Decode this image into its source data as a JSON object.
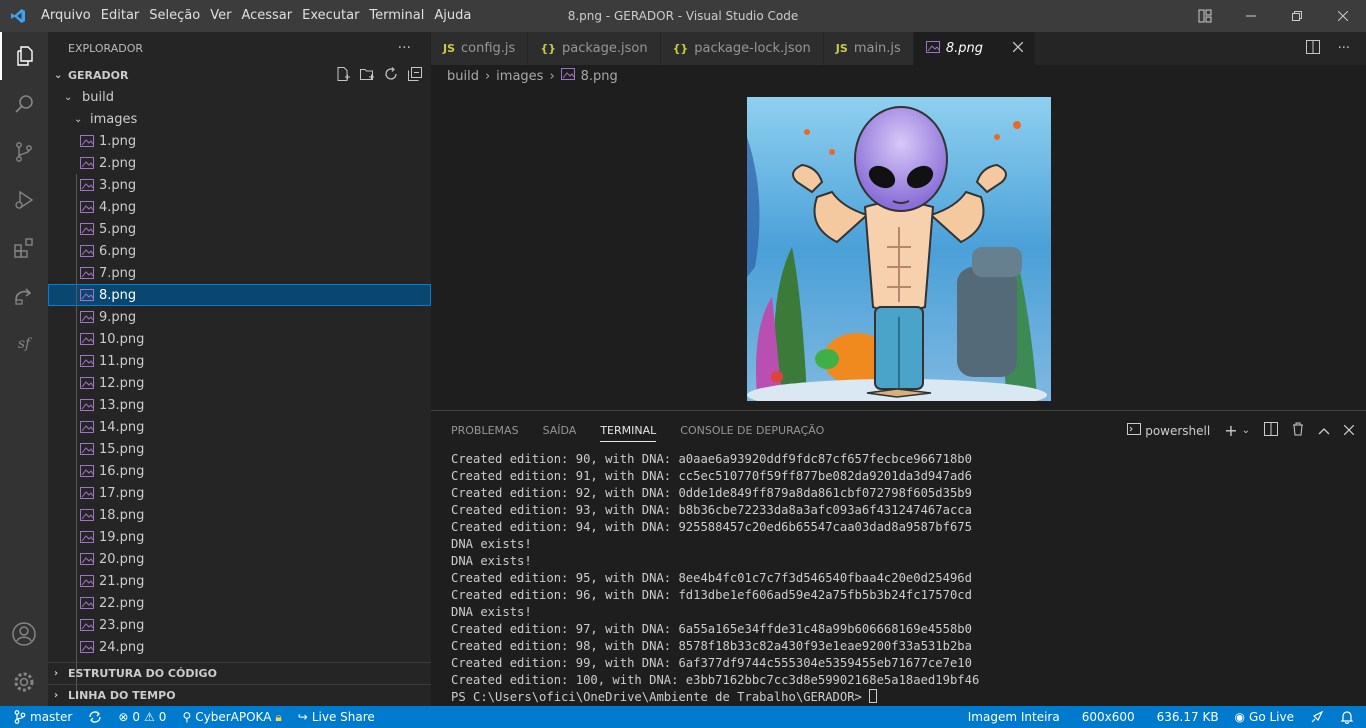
{
  "menu": [
    "Arquivo",
    "Editar",
    "Seleção",
    "Ver",
    "Acessar",
    "Executar",
    "Terminal",
    "Ajuda"
  ],
  "window_title": "8.png - GERADOR - Visual Studio Code",
  "explorer": {
    "title": "EXPLORADOR",
    "more": "···",
    "root": "GERADOR",
    "build": "build",
    "images": "images",
    "files": [
      "1.png",
      "2.png",
      "3.png",
      "4.png",
      "5.png",
      "6.png",
      "7.png",
      "8.png",
      "9.png",
      "10.png",
      "11.png",
      "12.png",
      "13.png",
      "14.png",
      "15.png",
      "16.png",
      "17.png",
      "18.png",
      "19.png",
      "20.png",
      "21.png",
      "22.png",
      "23.png",
      "24.png"
    ],
    "selected": "8.png",
    "outline": "ESTRUTURA DO CÓDIGO",
    "timeline": "LINHA DO TEMPO"
  },
  "tabs": [
    {
      "icon": "JS",
      "label": "config.js",
      "color": "#cbcb41"
    },
    {
      "icon": "{}",
      "label": "package.json",
      "color": "#cbcb41"
    },
    {
      "icon": "{}",
      "label": "package-lock.json",
      "color": "#cbcb41"
    },
    {
      "icon": "JS",
      "label": "main.js",
      "color": "#cbcb41"
    },
    {
      "icon": "img",
      "label": "8.png",
      "color": "#a074c4",
      "active": true
    }
  ],
  "breadcrumb": [
    "build",
    "images",
    "8.png"
  ],
  "panel": {
    "tabs": [
      "PROBLEMAS",
      "SAÍDA",
      "TERMINAL",
      "CONSOLE DE DEPURAÇÃO"
    ],
    "active_tab": "TERMINAL",
    "shell": "powershell",
    "lines": [
      "Created edition: 90, with DNA: a0aae6a93920ddf9fdc87cf657fecbce966718b0",
      "Created edition: 91, with DNA: cc5ec510770f59ff877be082da9201da3d947ad6",
      "Created edition: 92, with DNA: 0dde1de849ff879a8da861cbf072798f605d35b9",
      "Created edition: 93, with DNA: b8b36cbe72233da8a3afc093a6f431247467acca",
      "Created edition: 94, with DNA: 925588457c20ed6b65547caa03dad8a9587bf675",
      "DNA exists!",
      "DNA exists!",
      "Created edition: 95, with DNA: 8ee4b4fc01c7c7f3d546540fbaa4c20e0d25496d",
      "Created edition: 96, with DNA: fd13dbe1ef606ad59e42a75fb5b3b24fc17570cd",
      "DNA exists!",
      "Created edition: 97, with DNA: 6a55a165e34ffde31c48a99b606668169e4558b0",
      "Created edition: 98, with DNA: 8578f18b33c82a430f93e1eae9200f33a531b2ba",
      "Created edition: 99, with DNA: 6af377df9744c555304e5359455eb71677ce7e10",
      "Created edition: 100, with DNA: e3bb7162bbc7cc3d8e59902168e5a18aed19bf46"
    ],
    "prompt": "PS C:\\Users\\ofici\\OneDrive\\Ambiente de Trabalho\\GERADOR> "
  },
  "status": {
    "branch": "master",
    "errors": "0",
    "warnings": "0",
    "cyber": "CyberAPOKA",
    "live_share": "Live Share",
    "image_mode": "Imagem Inteira",
    "dimensions": "600x600",
    "size": "636.17 KB",
    "go_live": "Go Live"
  }
}
